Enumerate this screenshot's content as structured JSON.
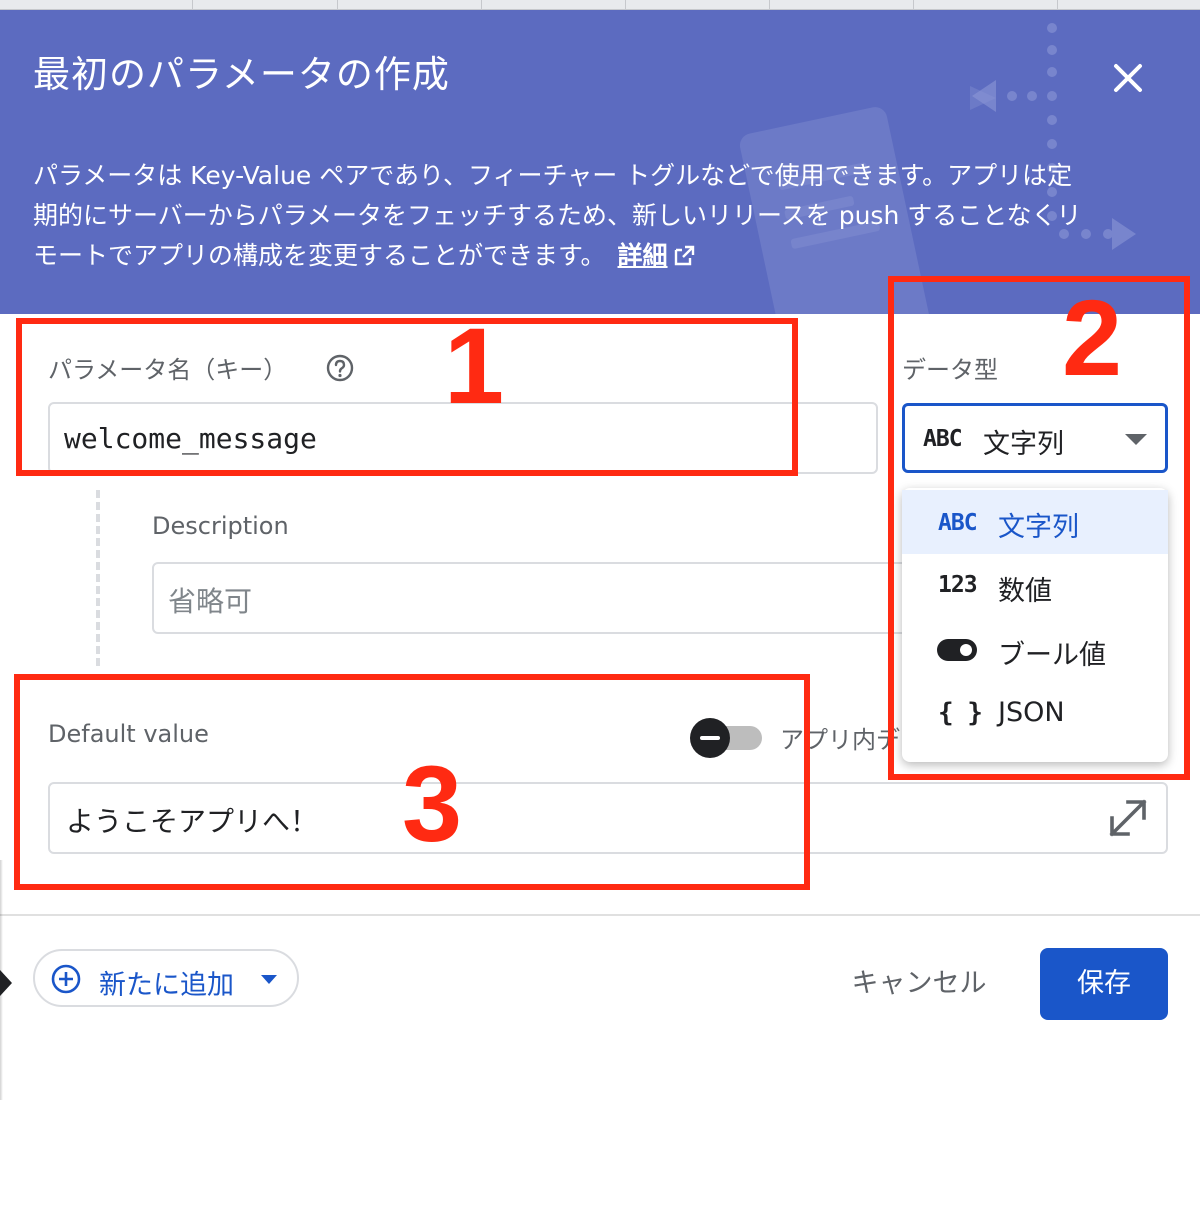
{
  "dialog": {
    "title": "最初のパラメータの作成",
    "description": "パラメータは Key-Value ペアであり、フィーチャー トグルなどで使用できます。アプリは定期的にサーバーからパラメータをフェッチするため、新しいリリースを push することなくリモートでアプリの構成を変更することができます。",
    "learn_more": "詳細"
  },
  "form": {
    "param_name_label": "パラメータ名（キー）",
    "param_name_value": "welcome_message",
    "data_type_label": "データ型",
    "data_type_selected": {
      "icon": "ABC",
      "label": "文字列"
    },
    "description_label": "Description",
    "description_placeholder": "省略可",
    "default_value_label": "Default value",
    "in_app_default_label": "アプリ内デ",
    "default_value": "ようこそアプリへ！"
  },
  "data_type_menu": [
    {
      "icon": "ABC",
      "icon_name": "abc-icon",
      "label": "文字列",
      "selected": true
    },
    {
      "icon": "123",
      "icon_name": "number-icon",
      "label": "数値",
      "selected": false
    },
    {
      "icon": "toggle",
      "icon_name": "toggle-icon",
      "label": "ブール値",
      "selected": false
    },
    {
      "icon": "{ }",
      "icon_name": "braces-icon",
      "label": "JSON",
      "selected": false
    }
  ],
  "footer": {
    "add_new": "新たに追加",
    "cancel": "キャンセル",
    "save": "保存"
  },
  "annotations": [
    "1",
    "2",
    "3"
  ],
  "colors": {
    "header_bg": "#5c6bc0",
    "primary": "#1a56c9",
    "annotation": "#ff2a12",
    "selected_bg": "#e8f0fe"
  }
}
